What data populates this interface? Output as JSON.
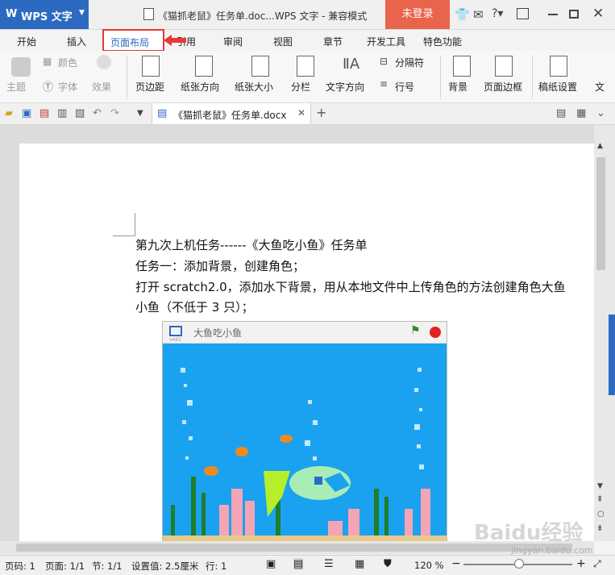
{
  "titlebar": {
    "app_logo": "W",
    "app_name": "WPS 文字",
    "doc_title": "《猫抓老鼠》任务单.doc...WPS 文字 - 兼容模式",
    "login": "未登录",
    "icons": [
      "shirt-icon",
      "chat-icon",
      "help-icon",
      "restore-icon",
      "minimize-icon",
      "maximize-icon",
      "close-icon"
    ]
  },
  "menu": {
    "tabs": [
      "开始",
      "插入",
      "页面布局",
      "引用",
      "审阅",
      "视图",
      "章节",
      "开发工具",
      "特色功能"
    ],
    "active": "页面布局"
  },
  "ribbon": {
    "theme": "主题",
    "color": "颜色",
    "font": "字体",
    "effect": "效果",
    "margins": "页边距",
    "orientation": "纸张方向",
    "size": "纸张大小",
    "columns": "分栏",
    "text_direction": "文字方向",
    "breaks": "分隔符",
    "line_numbers": "行号",
    "background": "背景",
    "page_border": "页面边框",
    "grid_settings": "稿纸设置",
    "more": "文"
  },
  "quick_access": {
    "doc_tab": "《猫抓老鼠》任务单.docx",
    "new_tab": "+"
  },
  "document": {
    "lines": [
      "第九次上机任务------《大鱼吃小鱼》任务单",
      "任务一：添加背景，创建角色；",
      "打开 scratch2.0，添加水下背景，用从本地文件中上传角色的方法创建角色大鱼",
      "小鱼（不低于 3 只）；"
    ],
    "stage_title": "大鱼吃小鱼",
    "stage_version": "v461"
  },
  "status": {
    "page": "页码: 1",
    "pages": "页面: 1/1",
    "section": "节: 1/1",
    "setting": "设置值: 2.5厘米",
    "row": "行: 1",
    "zoom": "120 %",
    "zoom_minus": "−",
    "zoom_plus": "+"
  },
  "watermark": {
    "brand": "Baidu经验",
    "url": "jingyan.baidu.com"
  },
  "colors": {
    "accent": "#2b6ac0",
    "login": "#e9644a",
    "highlight": "#e53935",
    "water": "#1aa2f0"
  }
}
